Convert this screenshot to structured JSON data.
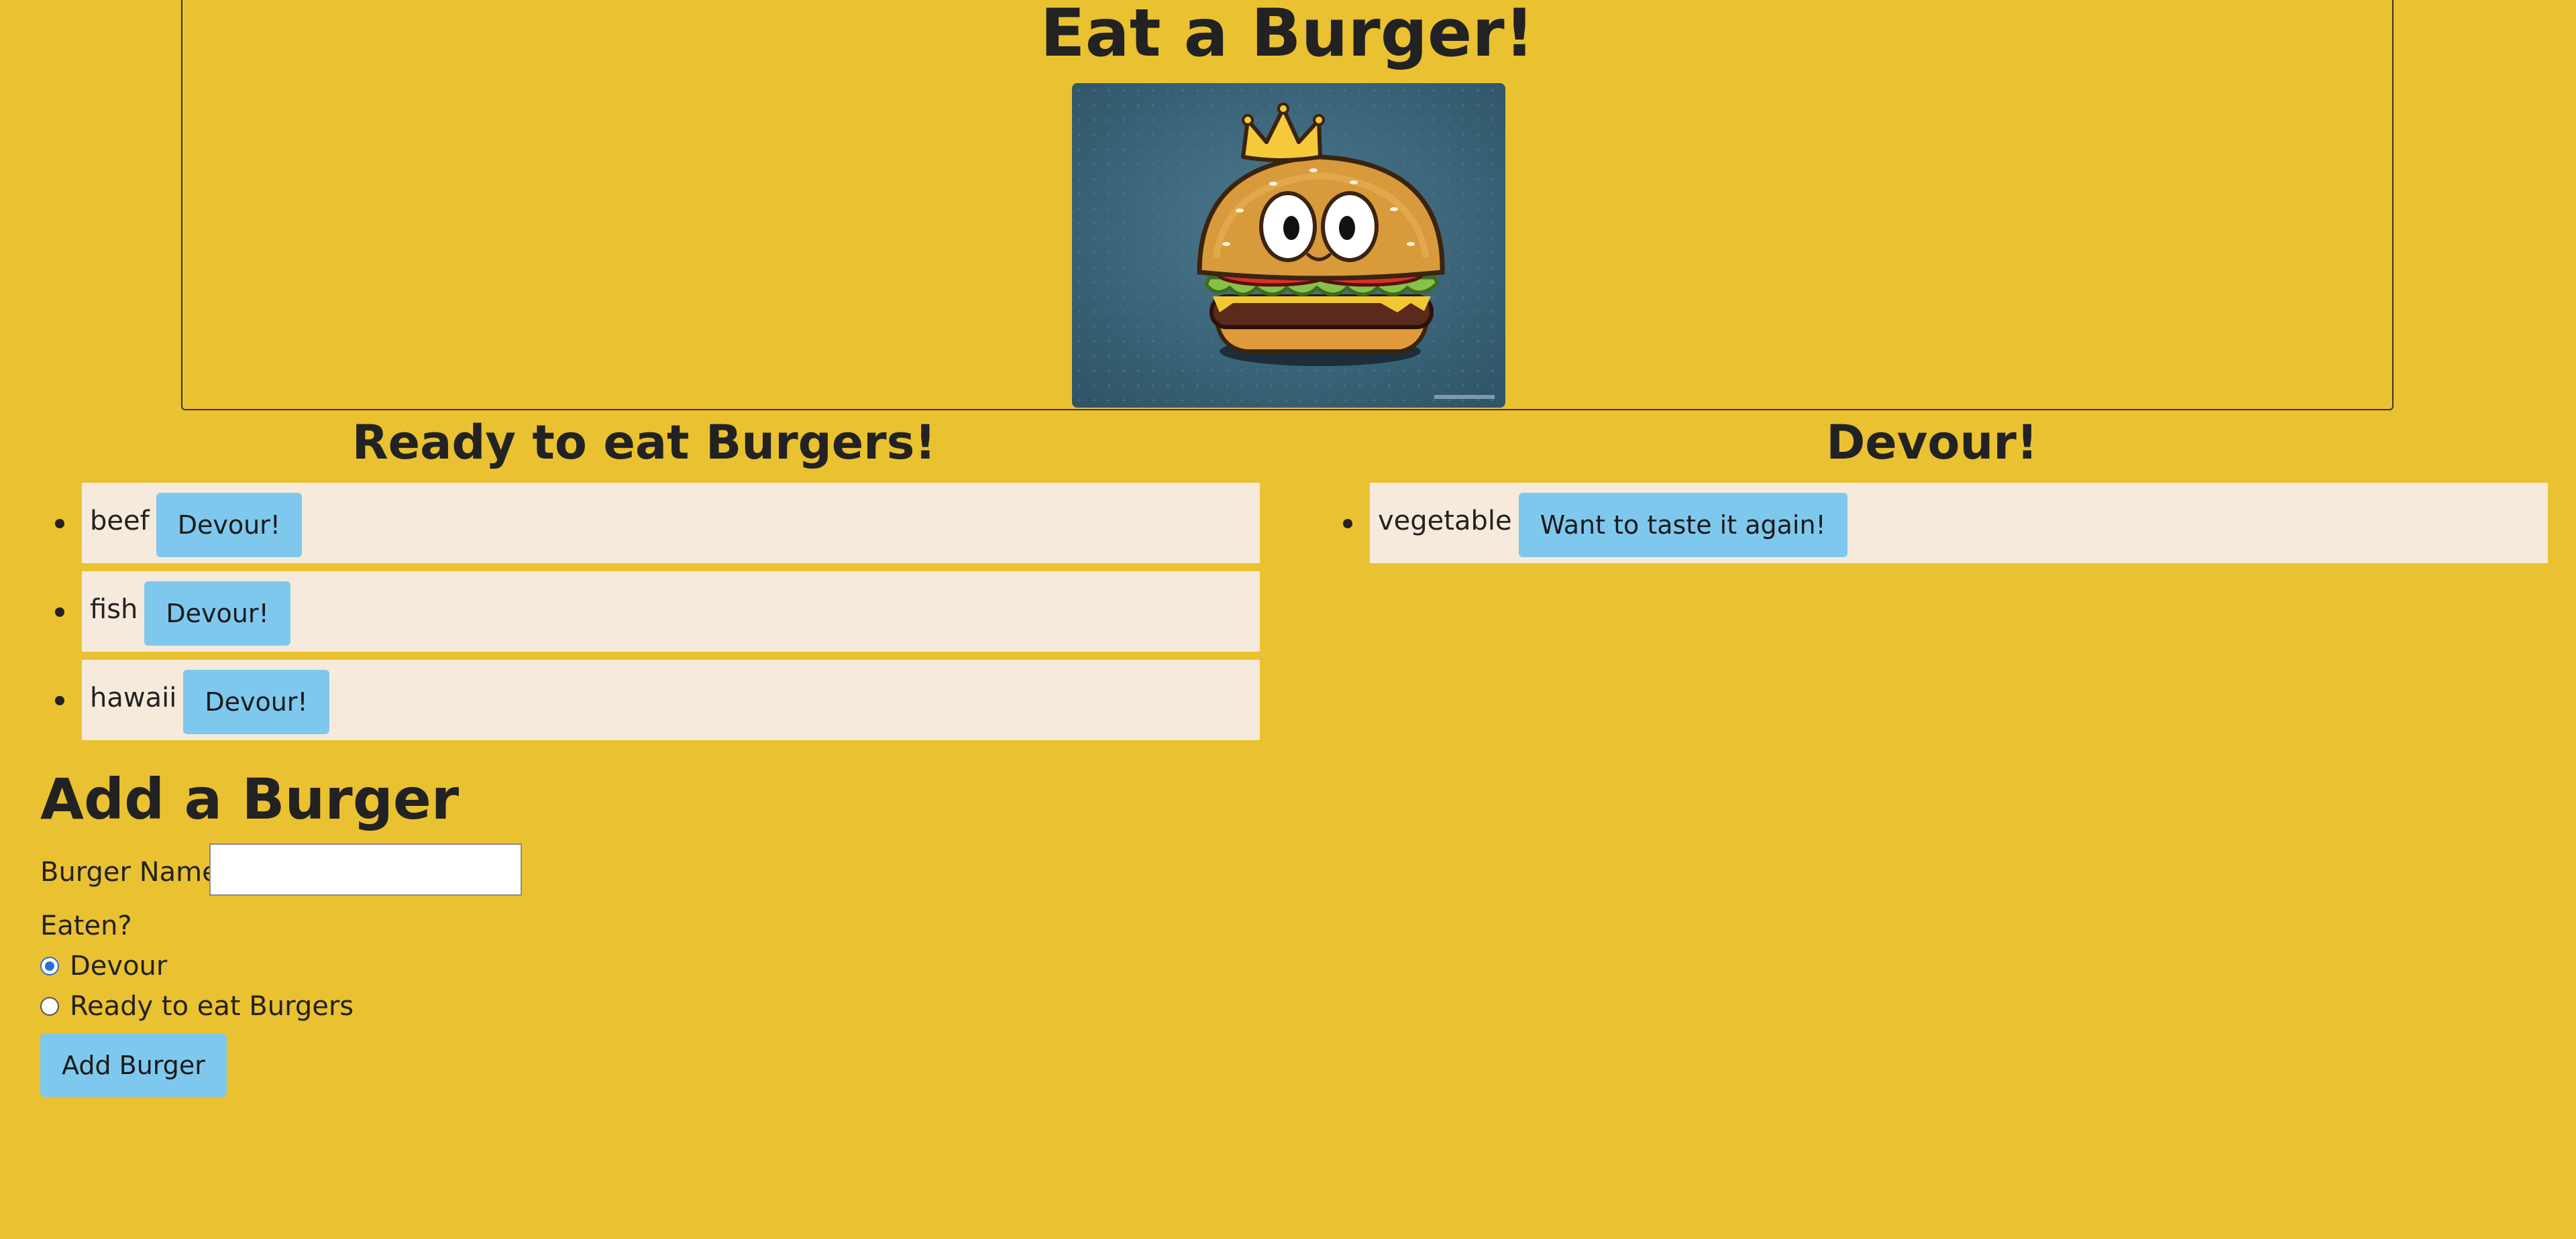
{
  "header": {
    "title": "Eat a Burger!"
  },
  "hero": {
    "icon": "burger-mascot-image"
  },
  "ready": {
    "heading": "Ready to eat Burgers!",
    "items": [
      {
        "name": "beef",
        "button": "Devour!"
      },
      {
        "name": "fish",
        "button": "Devour!"
      },
      {
        "name": "hawaii",
        "button": "Devour!"
      }
    ]
  },
  "devoured": {
    "heading": "Devour!",
    "items": [
      {
        "name": "vegetable",
        "button": "Want to taste it again!"
      }
    ]
  },
  "form": {
    "heading": "Add a Burger",
    "name_label": "Burger Name:",
    "name_value": "",
    "eaten_label": "Eaten?",
    "radio_options": [
      {
        "label": "Devour",
        "checked": true
      },
      {
        "label": "Ready to eat Burgers",
        "checked": false
      }
    ],
    "submit": "Add Burger"
  },
  "colors": {
    "background": "#eac130",
    "list_item": "#f6eadc",
    "button": "#7ec8ee"
  }
}
